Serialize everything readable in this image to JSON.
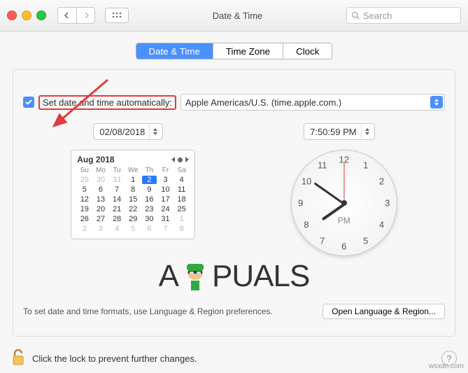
{
  "titlebar": {
    "title": "Date & Time",
    "search_placeholder": "Search"
  },
  "tabs": {
    "date_time": "Date & Time",
    "time_zone": "Time Zone",
    "clock": "Clock"
  },
  "auto": {
    "label": "Set date and time automatically:",
    "server": "Apple Americas/U.S. (time.apple.com.)"
  },
  "date_field": "02/08/2018",
  "time_field": "7:50:59 PM",
  "calendar": {
    "month": "Aug 2018",
    "days": [
      "Su",
      "Mo",
      "Tu",
      "We",
      "Th",
      "Fr",
      "Sa"
    ],
    "lead": [
      "29",
      "30",
      "31"
    ],
    "cells": [
      "1",
      "2",
      "3",
      "4",
      "5",
      "6",
      "7",
      "8",
      "9",
      "10",
      "11",
      "12",
      "13",
      "14",
      "15",
      "16",
      "17",
      "18",
      "19",
      "20",
      "21",
      "22",
      "23",
      "24",
      "25",
      "26",
      "27",
      "28",
      "29",
      "30",
      "31"
    ],
    "trail": [
      "1",
      "2",
      "3",
      "4",
      "5",
      "6",
      "7",
      "8"
    ],
    "today": "2"
  },
  "clock": {
    "pm": "PM",
    "nums": [
      "12",
      "1",
      "2",
      "3",
      "4",
      "5",
      "6",
      "7",
      "8",
      "9",
      "10",
      "11"
    ]
  },
  "format": {
    "hint": "To set date and time formats, use Language & Region preferences.",
    "button": "Open Language & Region..."
  },
  "footer": {
    "lock": "Click the lock to prevent further changes.",
    "help": "?"
  },
  "watermark": "wsxdn.com",
  "logo": {
    "a": "A",
    "rest": "PUALS"
  }
}
